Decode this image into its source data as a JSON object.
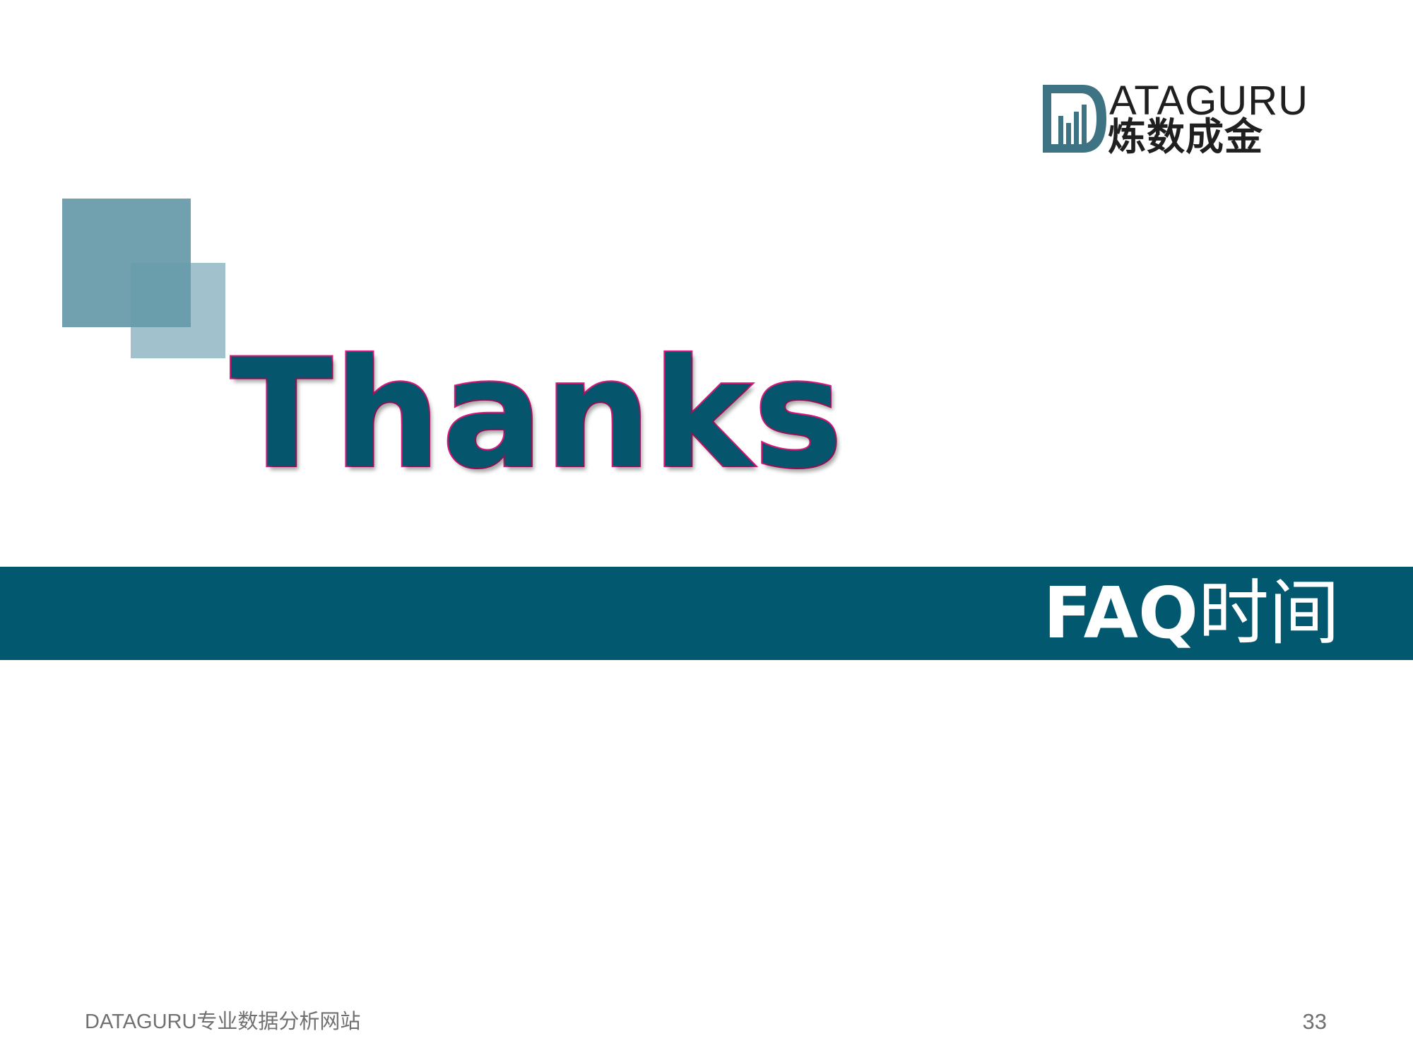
{
  "logo": {
    "english": "ATAGURU",
    "chinese": "炼数成金",
    "icon": "dataguru-logo-icon",
    "colors": {
      "frame": "#3e7384",
      "text": "#1f1f1f"
    }
  },
  "main": {
    "title": "Thanks",
    "title_fill": "#05566d",
    "title_outline": "#e0177c"
  },
  "band": {
    "title_latin": "FAQ",
    "title_cn": "时间",
    "background": "#02586f"
  },
  "footer": {
    "site_name": "DATAGURU专业数据分析网站",
    "page_number": "33"
  }
}
